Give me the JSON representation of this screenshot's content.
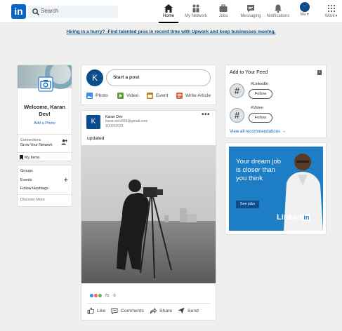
{
  "header": {
    "logo": "in",
    "search_placeholder": "Search",
    "nav": [
      {
        "label": "Home",
        "active": true
      },
      {
        "label": "My Network"
      },
      {
        "label": "Jobs"
      },
      {
        "label": "Messaging"
      },
      {
        "label": "Notifications"
      },
      {
        "label": "Me",
        "avatar": "K"
      },
      {
        "label": "Work"
      }
    ]
  },
  "promo": "Hiring in a hurry? -Find talented pros in record time with Upwork and keep businesses moving.",
  "profile": {
    "welcome": "Welcome, Karan Dev!",
    "add_photo": "Add a Photo",
    "connections_label": "Connections",
    "connections_sub": "Grow Your Network",
    "my_items": "My Items"
  },
  "groups": {
    "items": [
      "Groups",
      "Events",
      "Follow Hashtags"
    ],
    "discover": "Discover More"
  },
  "composer": {
    "avatar": "K",
    "placeholder": "Start a post",
    "actions": [
      "Photo",
      "Video",
      "Event",
      "Write Article"
    ]
  },
  "post": {
    "avatar": "K",
    "author": "Karan Dev",
    "email": "karan.dev066@gmail.com",
    "date": "10/10/2021",
    "text": "updated",
    "reactions": "75",
    "comments": "0",
    "actions": [
      "Like",
      "Comments",
      "Share",
      "Send"
    ]
  },
  "feed": {
    "title": "Add to Your Feed",
    "items": [
      {
        "name": "#LinkedIn",
        "action": "Follow"
      },
      {
        "name": "#Video",
        "action": "Follow"
      }
    ],
    "view_all": "View all recommendations →"
  },
  "ad": {
    "text": "Your dream job is closer than you think",
    "button": "See jobs",
    "brand": "Linked",
    "brand_in": "in"
  },
  "colors": {
    "accent": "#0a66c2",
    "background": "#eff0ee",
    "ad_blue": "#1d7ec5"
  }
}
